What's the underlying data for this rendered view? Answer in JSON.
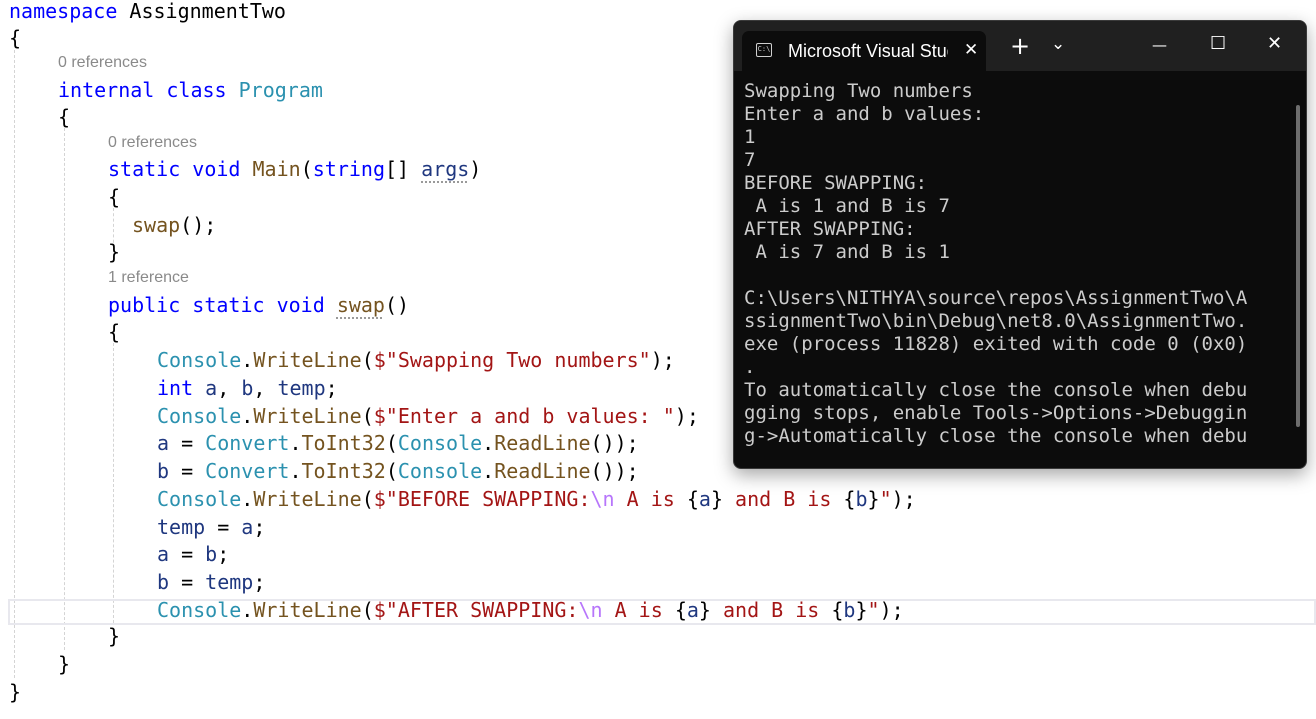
{
  "editor": {
    "codelens": {
      "class_refs": "0 references",
      "main_refs": "0 references",
      "swap_refs": "1 reference"
    },
    "lines": {
      "l1": [
        "namespace",
        " AssignmentTwo"
      ],
      "l2": [
        "{"
      ],
      "l3": [
        "internal",
        " ",
        "class",
        " ",
        "Program"
      ],
      "l4": [
        "{"
      ],
      "l5": [
        "static",
        " ",
        "void",
        " ",
        "Main",
        "(",
        "string",
        "[] ",
        "args",
        ")"
      ],
      "l6": [
        "{"
      ],
      "l7": [
        "swap",
        "();"
      ],
      "l8": [
        "}"
      ],
      "l9": [
        "public",
        " ",
        "static",
        " ",
        "void",
        " ",
        "swap",
        "()"
      ],
      "l10": [
        "{"
      ],
      "l11": [
        "Console",
        ".",
        "WriteLine",
        "(",
        "$\"Swapping Two numbers\"",
        ");"
      ],
      "l12": [
        "int",
        " ",
        "a",
        ", ",
        "b",
        ", ",
        "temp",
        ";"
      ],
      "l13": [
        "Console",
        ".",
        "WriteLine",
        "(",
        "$\"Enter a and b values: \"",
        ");"
      ],
      "l14": [
        "a",
        " = ",
        "Convert",
        ".",
        "ToInt32",
        "(",
        "Console",
        ".",
        "ReadLine",
        "());"
      ],
      "l15": [
        "b",
        " = ",
        "Convert",
        ".",
        "ToInt32",
        "(",
        "Console",
        ".",
        "ReadLine",
        "());"
      ],
      "l16": [
        "Console",
        ".",
        "WriteLine",
        "(",
        "$\"BEFORE SWAPPING:",
        "\\n",
        " A is ",
        "{",
        "a",
        "}",
        " and B is ",
        "{",
        "b",
        "}",
        "\"",
        ");"
      ],
      "l17": [
        "temp",
        " = ",
        "a",
        ";"
      ],
      "l18": [
        "a",
        " = ",
        "b",
        ";"
      ],
      "l19": [
        "b",
        " = ",
        "temp",
        ";"
      ],
      "l20": [
        "Console",
        ".",
        "WriteLine",
        "(",
        "$\"AFTER SWAPPING:",
        "\\n",
        " A is ",
        "{",
        "a",
        "}",
        " and B is ",
        "{",
        "b",
        "}",
        "\"",
        ");"
      ],
      "l21": [
        "}"
      ],
      "l22": [
        "}"
      ],
      "l23": [
        "}"
      ]
    }
  },
  "terminal": {
    "tab_title": "Microsoft Visual Studio Debug Console",
    "tab_icon_text": "C:\\",
    "close_tab": "✕",
    "new_tab": "+",
    "dropdown": "⌄",
    "minimize": "—",
    "maximize": "☐",
    "close_window": "✕",
    "output": [
      "Swapping Two numbers",
      "Enter a and b values:",
      "1",
      "7",
      "BEFORE SWAPPING:",
      " A is 1 and B is 7",
      "AFTER SWAPPING:",
      " A is 7 and B is 1",
      "",
      "C:\\Users\\NITHYA\\source\\repos\\AssignmentTwo\\A",
      "ssignmentTwo\\bin\\Debug\\net8.0\\AssignmentTwo.",
      "exe (process 11828) exited with code 0 (0x0)",
      ".",
      "To automatically close the console when debu",
      "gging stops, enable Tools->Options->Debuggin",
      "g->Automatically close the console when debu"
    ]
  }
}
